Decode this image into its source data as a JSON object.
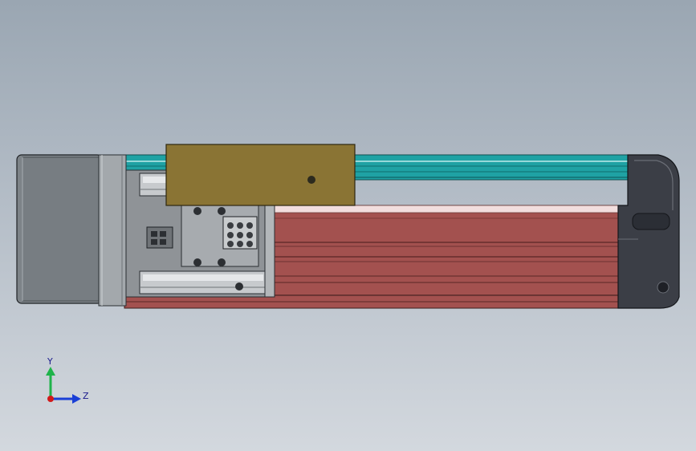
{
  "scene": {
    "background_top": "#9aa6b2",
    "background_bottom": "#d3d8de",
    "parts": {
      "motor_color": "#7d8388",
      "flange_color": "#a3a8ac",
      "rail_color": "#1fa2a4",
      "carriage_color": "#8a7434",
      "profile_color": "#a3514f",
      "profile_highlight": "#f2dede",
      "end_cap_color": "#3b3e46",
      "coupling_color": "#9b9fa3"
    }
  },
  "triad": {
    "y_label": "Y",
    "z_label": "Z",
    "y_color": "#1fb34a",
    "z_color": "#1a3fd6",
    "x_color": "#d21a1a"
  }
}
